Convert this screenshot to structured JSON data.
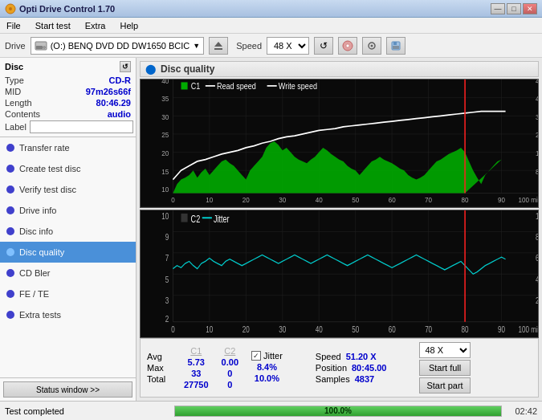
{
  "titleBar": {
    "title": "Opti Drive Control 1.70",
    "minBtn": "—",
    "maxBtn": "□",
    "closeBtn": "✕"
  },
  "menuBar": {
    "items": [
      "File",
      "Start test",
      "Extra",
      "Help"
    ]
  },
  "toolbar": {
    "driveLabel": "Drive",
    "driveName": "(O:)  BENQ DVD DD DW1650 BCIC",
    "speedLabel": "Speed",
    "speedValue": "48 X"
  },
  "disc": {
    "title": "Disc",
    "typeLabel": "Type",
    "typeValue": "CD-R",
    "midLabel": "MID",
    "midValue": "97m26s66f",
    "lengthLabel": "Length",
    "lengthValue": "80:46.29",
    "contentsLabel": "Contents",
    "contentsValue": "audio",
    "labelLabel": "Label",
    "labelValue": ""
  },
  "navItems": [
    {
      "id": "transfer-rate",
      "label": "Transfer rate",
      "active": false
    },
    {
      "id": "create-test-disc",
      "label": "Create test disc",
      "active": false
    },
    {
      "id": "verify-test-disc",
      "label": "Verify test disc",
      "active": false
    },
    {
      "id": "drive-info",
      "label": "Drive info",
      "active": false
    },
    {
      "id": "disc-info",
      "label": "Disc info",
      "active": false
    },
    {
      "id": "disc-quality",
      "label": "Disc quality",
      "active": true
    },
    {
      "id": "cd-bler",
      "label": "CD Bler",
      "active": false
    },
    {
      "id": "fe-te",
      "label": "FE / TE",
      "active": false
    },
    {
      "id": "extra-tests",
      "label": "Extra tests",
      "active": false
    }
  ],
  "statusWindow": "Status window >>",
  "chartTitle": "Disc quality",
  "chart1": {
    "legend": [
      "C1",
      "Read speed",
      "Write speed"
    ],
    "yMax": 48,
    "yMin": 0,
    "xMax": 100,
    "redLineX": 80
  },
  "chart2": {
    "legend": [
      "C2",
      "Jitter"
    ],
    "yMax": 10,
    "yMin": 0,
    "xMax": 100,
    "redLineX": 80
  },
  "stats": {
    "headers": [
      "",
      "C1",
      "C2",
      "Jitter",
      "Speed",
      ""
    ],
    "avgLabel": "Avg",
    "avgC1": "5.73",
    "avgC2": "0.00",
    "avgJitter": "8.4%",
    "maxLabel": "Max",
    "maxC1": "33",
    "maxC2": "0",
    "maxJitter": "10.0%",
    "totalLabel": "Total",
    "totalC1": "27750",
    "totalC2": "0",
    "speedValue": "51.20 X",
    "positionLabel": "Position",
    "positionValue": "80:45.00",
    "samplesLabel": "Samples",
    "samplesValue": "4837",
    "jitterChecked": true,
    "speedSelect": "48 X",
    "startFull": "Start full",
    "startPart": "Start part"
  },
  "statusBar": {
    "text": "Test completed",
    "progress": 100,
    "progressText": "100.0%",
    "time": "02:42"
  },
  "colors": {
    "c1Fill": "#00cc00",
    "c1Line": "#ffffff",
    "c2Fill": "none",
    "jitterLine": "#00cccc",
    "readSpeedLine": "#ffffff",
    "redLine": "#ff0000",
    "chartBg": "#1a1a1a"
  }
}
